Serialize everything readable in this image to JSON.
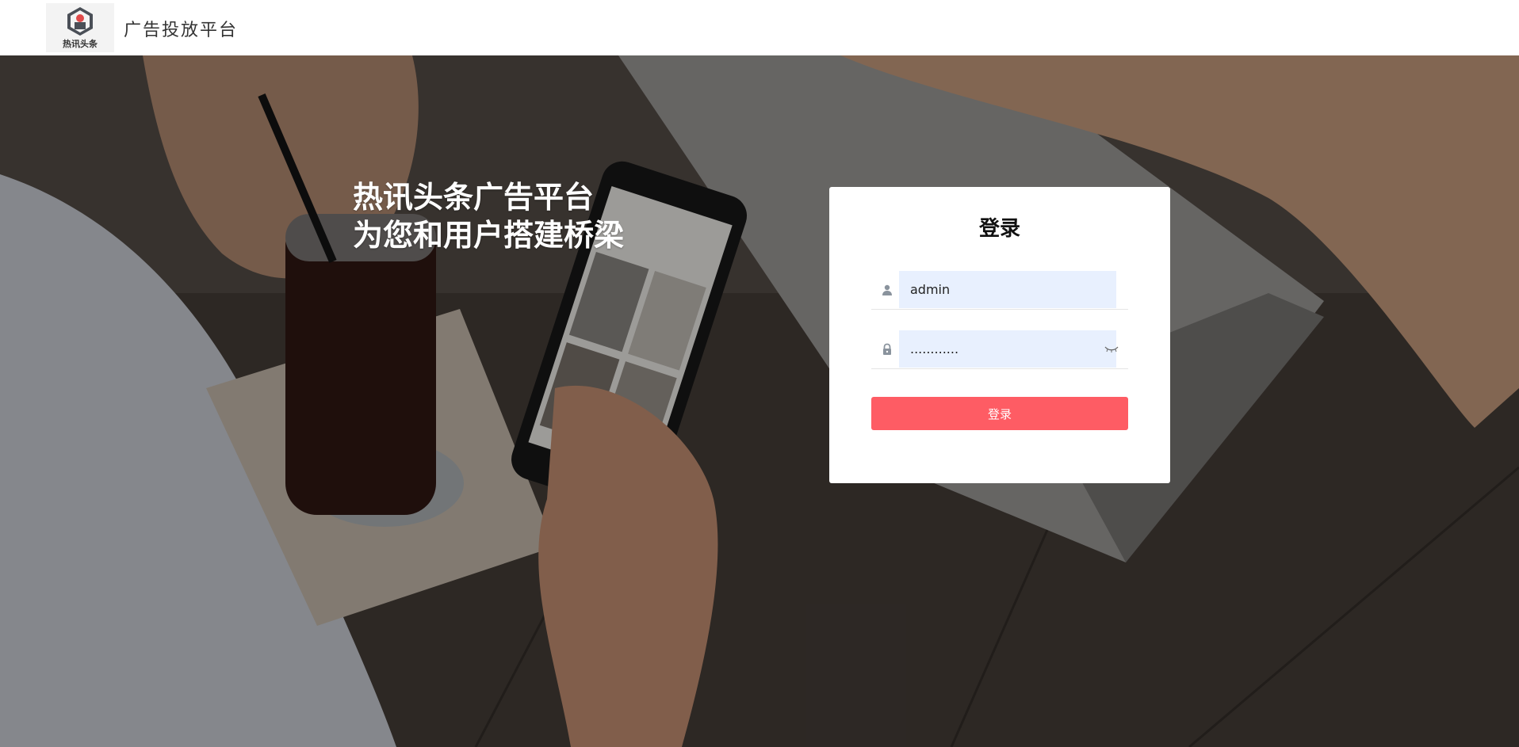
{
  "header": {
    "logo_text": "热讯头条",
    "platform_name": "广告投放平台"
  },
  "hero": {
    "slogan_line1": "热讯头条广告平台",
    "slogan_line2": "为您和用户搭建桥梁"
  },
  "login": {
    "title": "登录",
    "username_value": "admin",
    "password_value": "............",
    "submit_label": "登录",
    "accent_color": "#fe5c64",
    "input_bg_color": "#e8f0fe"
  }
}
